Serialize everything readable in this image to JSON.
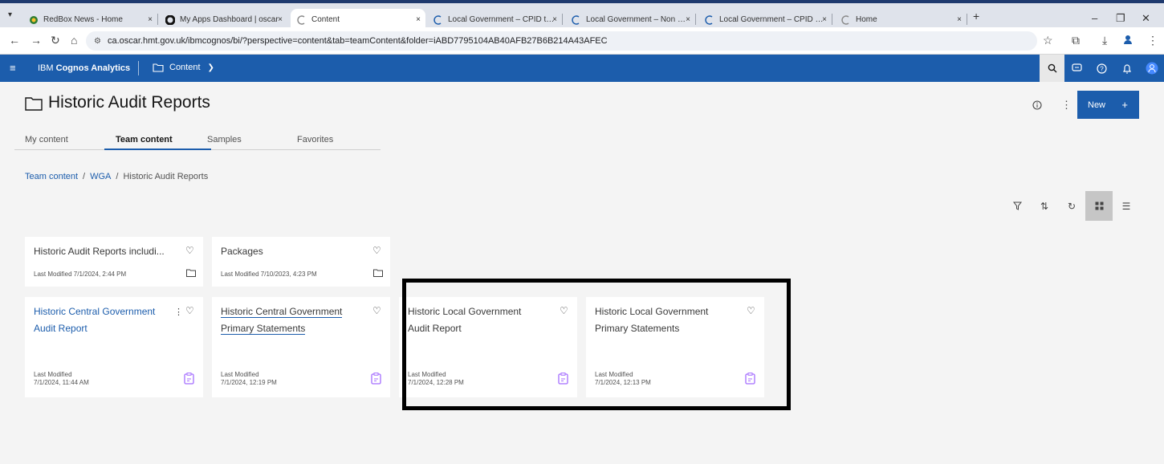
{
  "browser": {
    "tabs": [
      {
        "title": "RedBox News - Home",
        "icon": "redbox-icon"
      },
      {
        "title": "My Apps Dashboard | oscar",
        "icon": "okta-icon"
      },
      {
        "title": "Content",
        "icon": "cognos-tab-icon"
      },
      {
        "title": "Local Government – CPID trans",
        "icon": "cognos-tab-icon"
      },
      {
        "title": "Local Government – Non CPID",
        "icon": "cognos-tab-icon"
      },
      {
        "title": "Local Government – CPID trans",
        "icon": "cognos-tab-icon"
      },
      {
        "title": "Home",
        "icon": "cognos-tab-icon"
      }
    ],
    "close_glyph": "×",
    "new_tab_glyph": "+",
    "url": "ca.oscar.hmt.gov.uk/ibmcognos/bi/?perspective=content&tab=teamContent&folder=iABD7795104AB40AFB27B6B214A43AFEC"
  },
  "app": {
    "brand_prefix": "IBM ",
    "brand_name": "Cognos Analytics",
    "context_label": "Content"
  },
  "page": {
    "title": "Historic Audit Reports",
    "new_button": "New",
    "tabs": [
      "My content",
      "Team content",
      "Samples",
      "Favorites"
    ],
    "active_tab": "Team content",
    "breadcrumb": [
      "Team content",
      "WGA",
      "Historic Audit Reports"
    ]
  },
  "cards": [
    {
      "title_line1": "Historic Audit Reports includi...",
      "title_line2": "",
      "meta": "Last Modified 7/1/2024, 2:44 PM",
      "type": "folder"
    },
    {
      "title_line1": "Packages",
      "title_line2": "",
      "meta": "Last Modified 7/10/2023, 4:23 PM",
      "type": "folder"
    },
    {
      "title_line1": "Historic Central Government",
      "title_line2": "Audit Report",
      "meta_label": "Last Modified",
      "meta_value": "7/1/2024, 11:44 AM",
      "type": "report"
    },
    {
      "title_line1": "Historic Central Government",
      "title_line2": "Primary Statements",
      "meta_label": "Last Modified",
      "meta_value": "7/1/2024, 12:19 PM",
      "type": "report"
    },
    {
      "title_line1": "Historic Local Government",
      "title_line2": "Audit Report",
      "meta_label": "Last Modified",
      "meta_value": "7/1/2024, 12:28 PM",
      "type": "report"
    },
    {
      "title_line1": "Historic Local Government",
      "title_line2": "Primary Statements",
      "meta_label": "Last Modified",
      "meta_value": "7/1/2024, 12:13 PM",
      "type": "report"
    }
  ],
  "colors": {
    "brand_blue": "#1c5dac",
    "report_icon": "#a56eff"
  }
}
